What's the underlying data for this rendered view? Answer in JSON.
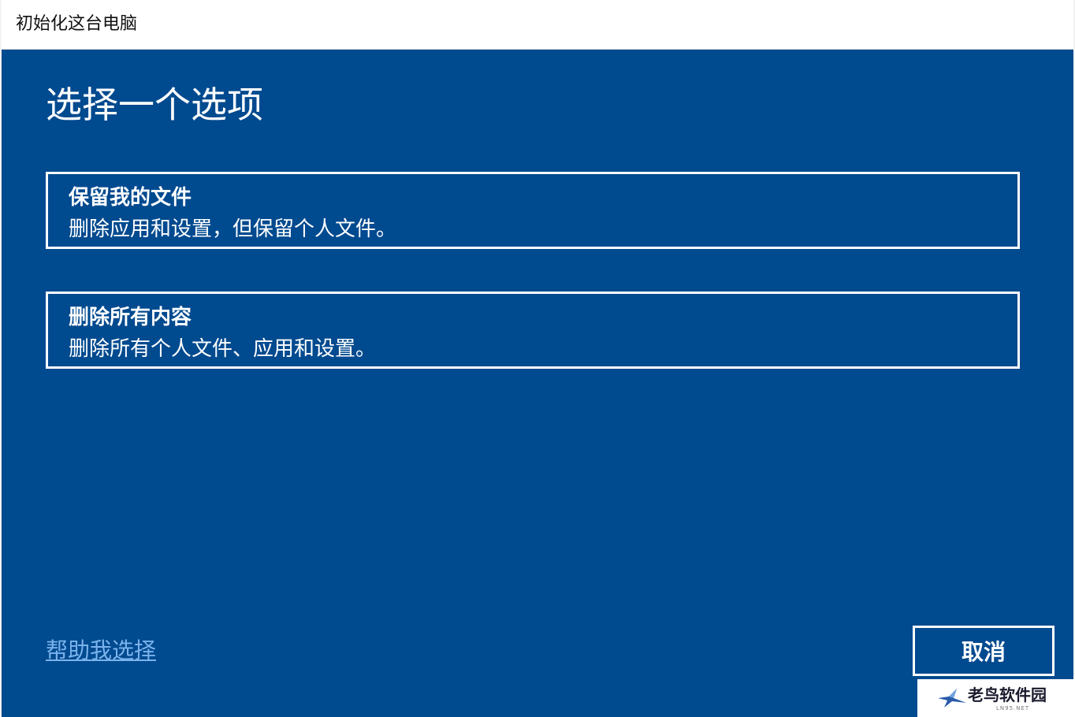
{
  "window": {
    "title": "初始化这台电脑"
  },
  "dialog": {
    "heading": "选择一个选项",
    "options": [
      {
        "title": "保留我的文件",
        "description": "删除应用和设置，但保留个人文件。"
      },
      {
        "title": "删除所有内容",
        "description": "删除所有个人文件、应用和设置。"
      }
    ],
    "help_link": "帮助我选择",
    "cancel_label": "取消"
  },
  "watermark": {
    "text": "老鸟软件园",
    "subtext": "LN95.NET",
    "icon": "bird-logo-icon"
  },
  "colors": {
    "panel_background": "#004a8f",
    "link": "#7bb3ec",
    "text": "#ffffff"
  }
}
